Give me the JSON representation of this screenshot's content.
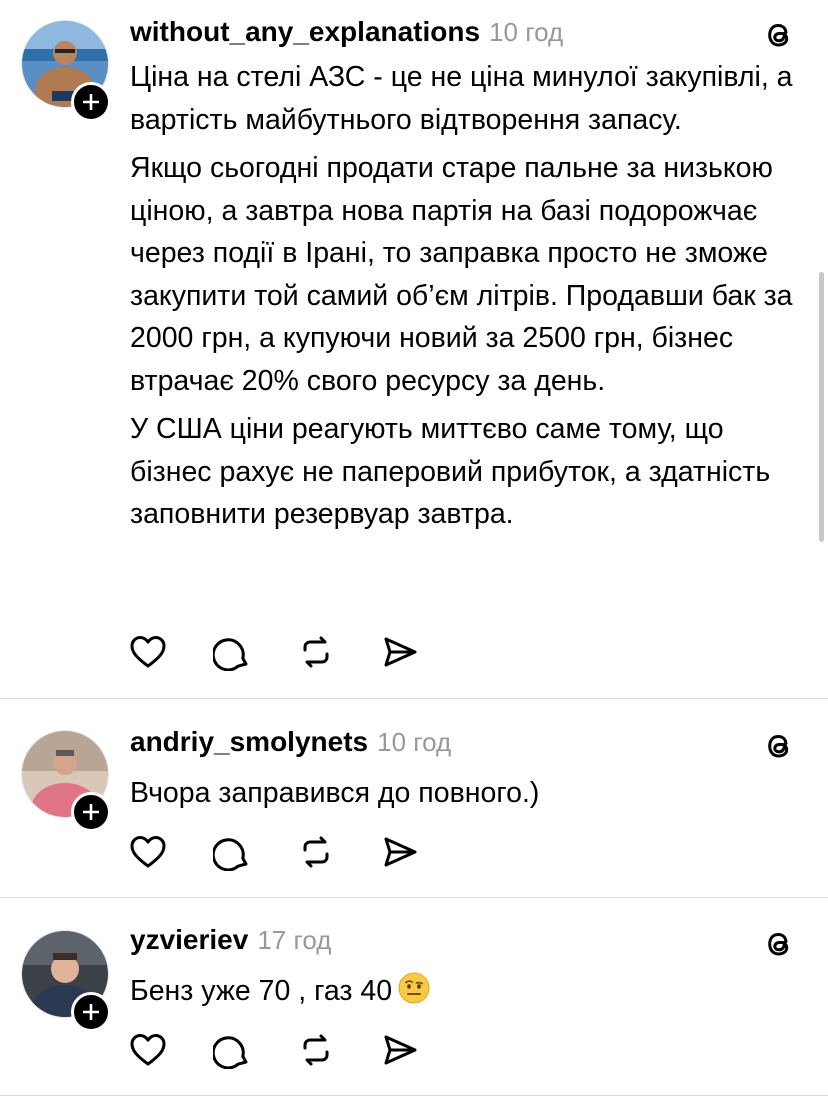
{
  "posts": [
    {
      "username": "without_any_explanations",
      "time": "10 год",
      "paragraphs": [
        "Ціна на стелі АЗС - це не ціна минулої закупівлі, а вартість майбутнього відтворення запасу.",
        "Якщо сьогодні продати старе пальне за низькою ціною, а завтра нова партія на базі подорожчає через події в Ірані, то заправка просто не зможе закупити той самий об’єм літрів. Продавши бак за 2000 грн, а купуючи новий за 2500 грн, бізнес втрачає 20% свого ресурсу за день.",
        "У США ціни реагують миттєво саме тому, що бізнес рахує не паперовий прибуток, а здатність заповнити резервуар завтра."
      ]
    },
    {
      "username": "andriy_smolynets",
      "time": "10 год",
      "paragraphs": [
        "Вчора заправився до повного.)"
      ]
    },
    {
      "username": "yzvieriev",
      "time": "17 год",
      "paragraphs": [
        "Бенз уже 70 , газ 40"
      ],
      "emoji": "face-with-raised-eyebrow"
    }
  ],
  "icons": {
    "platform": "threads-icon",
    "follow": "plus-icon",
    "like": "heart-icon",
    "reply": "comment-icon",
    "repost": "repost-icon",
    "share": "send-icon"
  },
  "colors": {
    "text": "#000000",
    "secondary": "#999999",
    "divider": "#dcdcdc",
    "background": "#ffffff"
  }
}
